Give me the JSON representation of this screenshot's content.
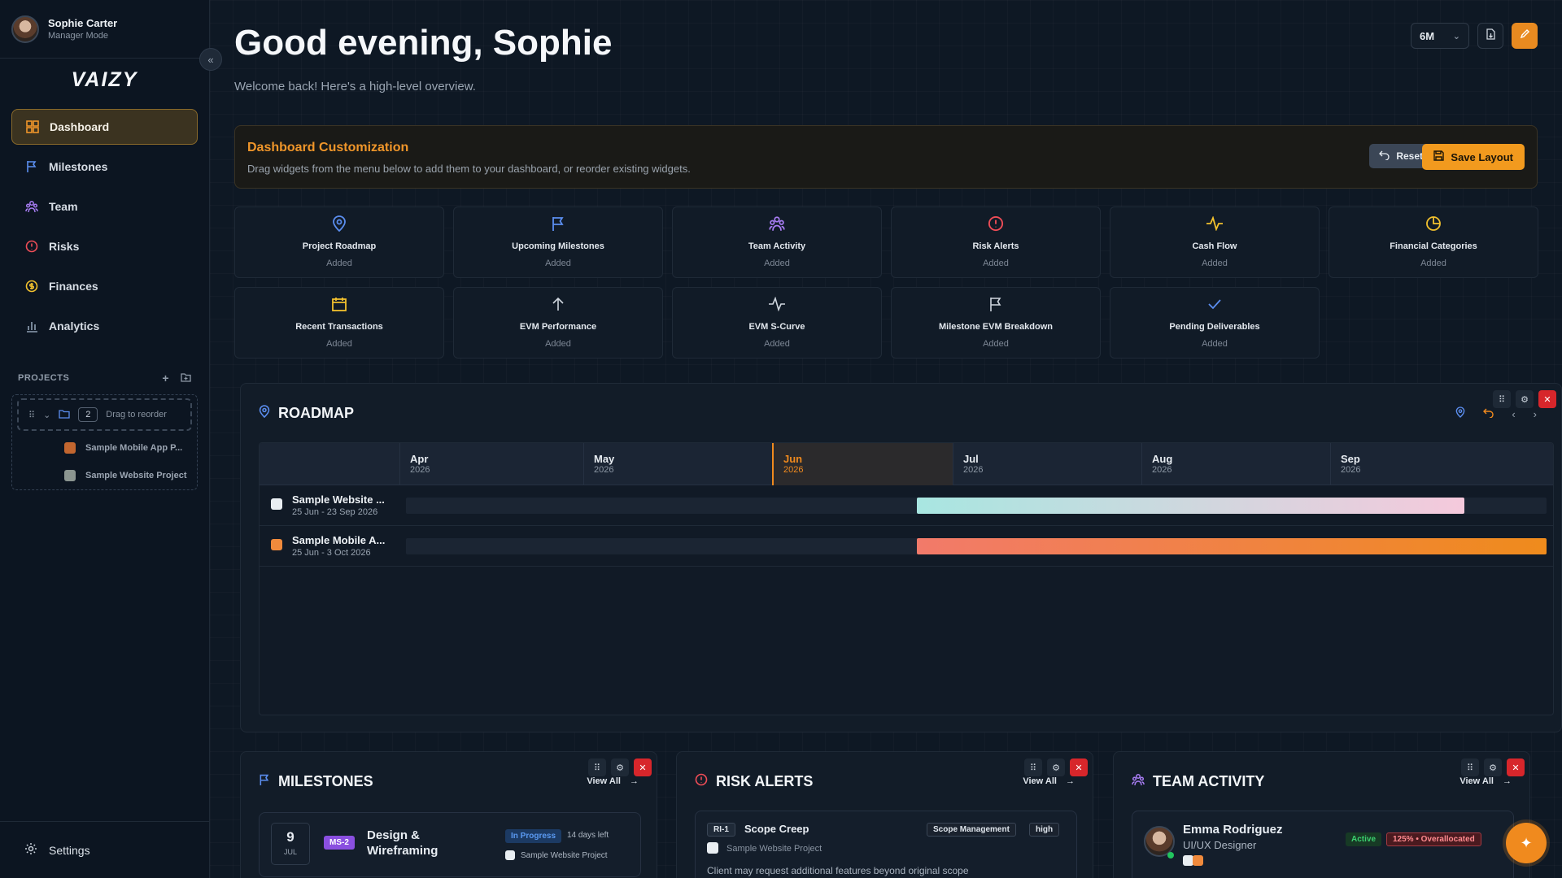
{
  "user": {
    "name": "Sophie Carter",
    "role": "Manager Mode"
  },
  "brand": {
    "logo": "VAIZY"
  },
  "nav": [
    {
      "label": "Dashboard",
      "icon": "dashboard-icon"
    },
    {
      "label": "Milestones",
      "icon": "flag-icon"
    },
    {
      "label": "Team",
      "icon": "team-icon"
    },
    {
      "label": "Risks",
      "icon": "alert-icon"
    },
    {
      "label": "Finances",
      "icon": "coin-icon"
    },
    {
      "label": "Analytics",
      "icon": "bar-chart-icon"
    }
  ],
  "projects": {
    "header": "PROJECTS",
    "count": "2",
    "drag_hint": "Drag to reorder",
    "items": [
      {
        "label": "Sample Mobile App P...",
        "color": "#c2662f"
      },
      {
        "label": "Sample Website Project",
        "color": "#8b9590"
      }
    ]
  },
  "settings_label": "Settings",
  "header": {
    "greeting": "Good evening, Sophie",
    "subtitle": "Welcome back! Here's a high-level overview.",
    "range": "6M"
  },
  "customization": {
    "title": "Dashboard Customization",
    "description": "Drag widgets from the menu below to add them to your dashboard, or reorder existing widgets.",
    "reset_label": "Reset",
    "save_label": "Save Layout"
  },
  "widgets": [
    {
      "title": "Project Roadmap",
      "status": "Added",
      "icon": "map-pin-icon",
      "color": "#5b8ef0"
    },
    {
      "title": "Upcoming Milestones",
      "status": "Added",
      "icon": "flag-icon",
      "color": "#5b8ef0"
    },
    {
      "title": "Team Activity",
      "status": "Added",
      "icon": "team-icon",
      "color": "#a77cf2"
    },
    {
      "title": "Risk Alerts",
      "status": "Added",
      "icon": "alert-icon",
      "color": "#ef4d57"
    },
    {
      "title": "Cash Flow",
      "status": "Added",
      "icon": "pulse-icon",
      "color": "#f2c12e"
    },
    {
      "title": "Financial Categories",
      "status": "Added",
      "icon": "pie-icon",
      "color": "#f2c12e"
    },
    {
      "title": "Recent Transactions",
      "status": "Added",
      "icon": "receipt-icon",
      "color": "#f2c12e"
    },
    {
      "title": "EVM Performance",
      "status": "Added",
      "icon": "arrow-up-icon",
      "color": "#cfd6de"
    },
    {
      "title": "EVM S-Curve",
      "status": "Added",
      "icon": "pulse-icon",
      "color": "#cfd6de"
    },
    {
      "title": "Milestone EVM Breakdown",
      "status": "Added",
      "icon": "flag-icon",
      "color": "#cfd6de"
    },
    {
      "title": "Pending Deliverables",
      "status": "Added",
      "icon": "check-icon",
      "color": "#5b8ef0"
    }
  ],
  "roadmap": {
    "title": "ROADMAP",
    "months": [
      {
        "name": "Apr",
        "year": "2026"
      },
      {
        "name": "May",
        "year": "2026"
      },
      {
        "name": "Jun",
        "year": "2026",
        "current": true
      },
      {
        "name": "Jul",
        "year": "2026"
      },
      {
        "name": "Aug",
        "year": "2026"
      },
      {
        "name": "Sep",
        "year": "2026"
      }
    ],
    "rows": [
      {
        "name": "Sample Website ...",
        "dates": "25 Jun - 23 Sep 2026",
        "color": "#e9eef2",
        "bar_colors": [
          "#a8e6e1",
          "#f5c9dc"
        ]
      },
      {
        "name": "Sample Mobile A...",
        "dates": "25 Jun - 3 Oct 2026",
        "color": "#f08a3c",
        "bar_colors": [
          "#f27a6a",
          "#ef8b1c"
        ]
      }
    ]
  },
  "milestones": {
    "title": "MILESTONES",
    "view_all": "View All",
    "item": {
      "day": "9",
      "month": "JUL",
      "code": "MS-2",
      "title": "Design & Wireframing",
      "status": "In Progress",
      "due": "14 days left",
      "project": "Sample Website Project"
    }
  },
  "risks": {
    "title": "RISK ALERTS",
    "view_all": "View All",
    "item": {
      "code": "RI-1",
      "title": "Scope Creep",
      "category": "Scope Management",
      "level": "high",
      "project": "Sample Website Project",
      "desc": "Client may request additional features beyond original scope"
    }
  },
  "team": {
    "title": "TEAM ACTIVITY",
    "view_all": "View All",
    "member": {
      "name": "Emma Rodriguez",
      "role": "UI/UX Designer",
      "status": "Active",
      "allocation": "125% • Overallocated"
    }
  }
}
